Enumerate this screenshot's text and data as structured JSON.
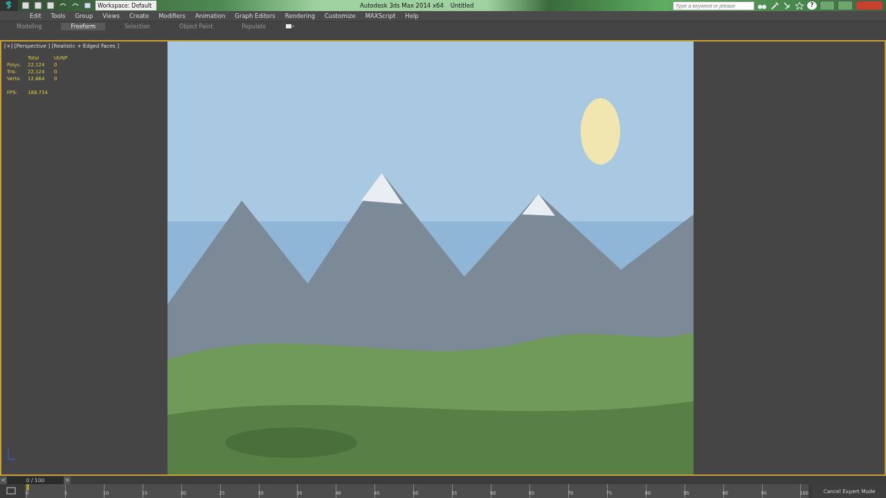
{
  "window": {
    "workspace": "Workspace: Default",
    "title": "Autodesk 3ds Max  2014 x64",
    "document": "Untitled"
  },
  "search": {
    "placeholder": "Type a keyword or phrase"
  },
  "help": "?",
  "menu": [
    "Edit",
    "Tools",
    "Group",
    "Views",
    "Create",
    "Modifiers",
    "Animation",
    "Graph Editors",
    "Rendering",
    "Customize",
    "MAXScript",
    "Help"
  ],
  "ribbon_tabs": [
    {
      "label": "Modeling",
      "selected": false
    },
    {
      "label": "Freeform",
      "selected": true
    },
    {
      "label": "Selection",
      "selected": false
    },
    {
      "label": "Object Paint",
      "selected": false
    },
    {
      "label": "Populate",
      "selected": false
    }
  ],
  "viewport": {
    "label": "[+] [Perspective ] [Realistic + Edged Faces ]",
    "stats_header": [
      "Total",
      "UUNP"
    ],
    "stats": [
      {
        "name": "Polys:",
        "total": "22,124",
        "object": "0"
      },
      {
        "name": "Tris:",
        "total": "22,124",
        "object": "0"
      },
      {
        "name": "Verts:",
        "total": "12,664",
        "object": "0"
      }
    ],
    "fps_label": "FPS:",
    "fps": "188.734",
    "content": {
      "kind": "picture"
    }
  },
  "time_slider": {
    "prev": "<",
    "frame": "0 / 100",
    "next": ">",
    "level": 0
  },
  "track_ticks": [
    "0",
    "5",
    "10",
    "15",
    "20",
    "25",
    "30",
    "35",
    "40",
    "45",
    "50",
    "55",
    "60",
    "65",
    "70",
    "75",
    "80",
    "85",
    "90",
    "95",
    "100"
  ],
  "cancel_button": "Cancel Expert Mode"
}
